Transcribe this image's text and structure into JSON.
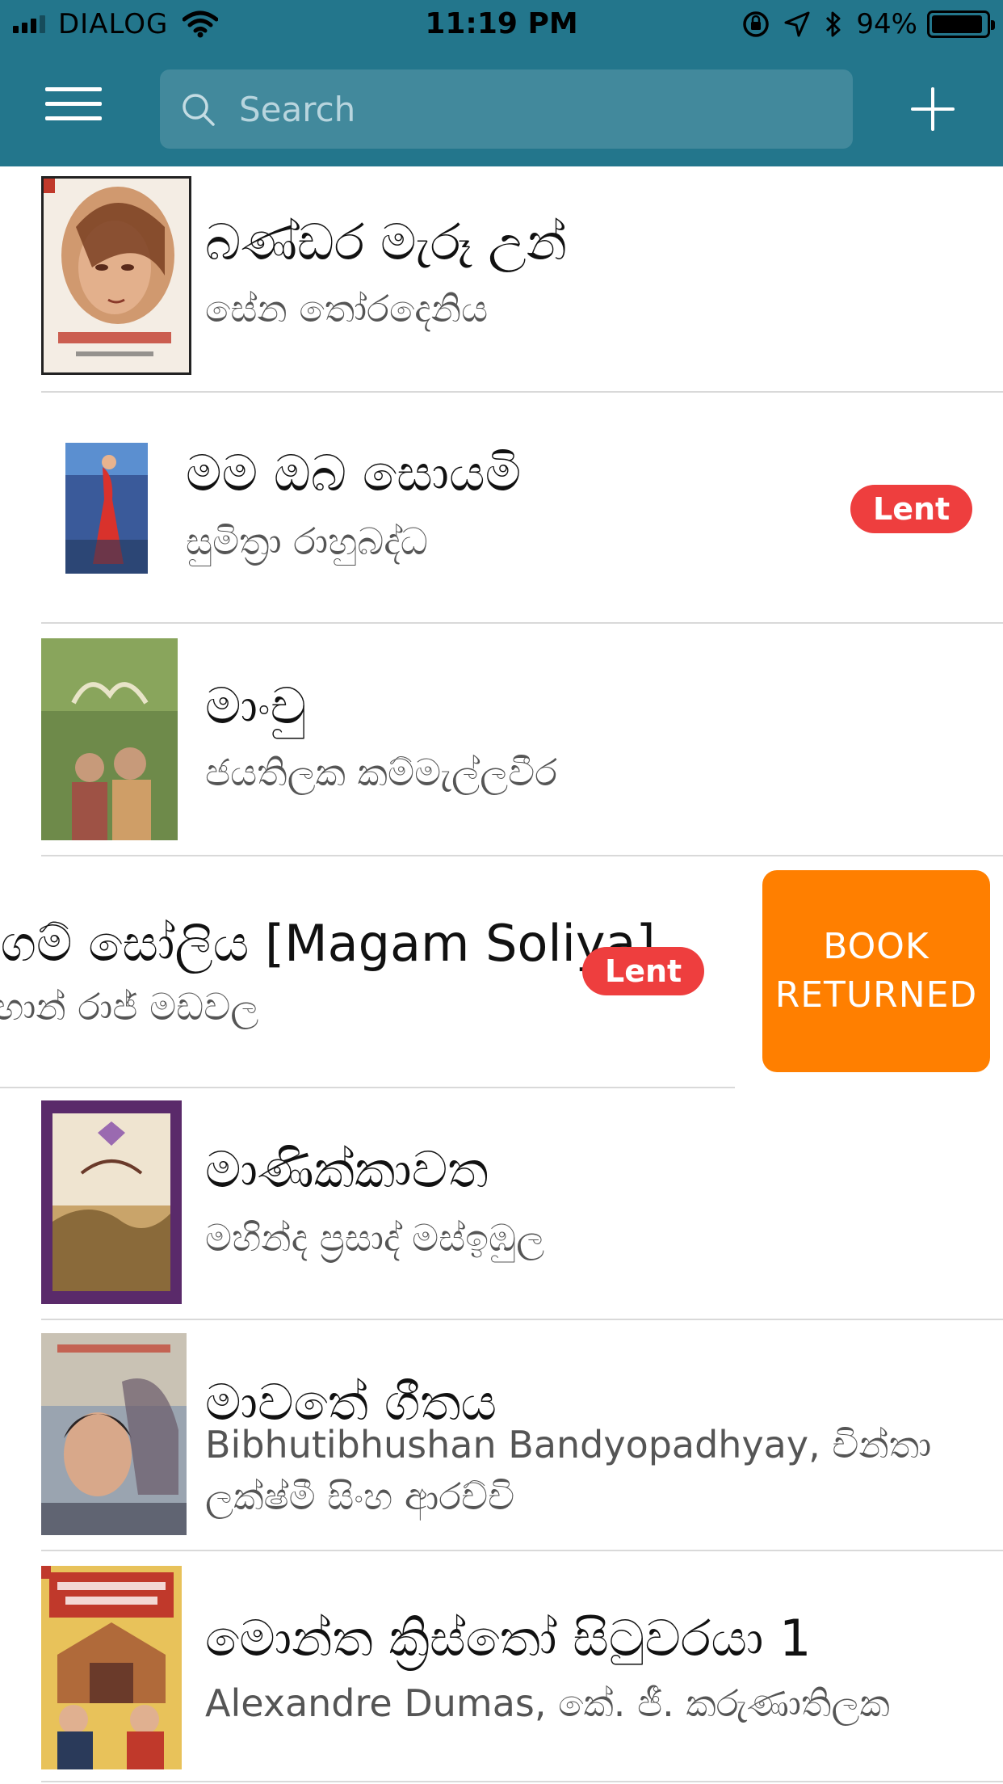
{
  "status_bar": {
    "carrier": "DIALOG",
    "time": "11:19 PM",
    "battery": "94%",
    "battery_level": 0.94
  },
  "header": {
    "search_placeholder": "Search"
  },
  "colors": {
    "header": "#23768c",
    "lent_badge": "#ee3e3e",
    "action_button": "#ff7f00"
  },
  "books": [
    {
      "title": "බණ්ඩර මැරූ උන්",
      "author": "සේන තෝරදෙනිය",
      "lent": false
    },
    {
      "title": "මම ඔබ සොයමි",
      "author": "සුමිත්‍රා රාහුබද්ධ",
      "lent": true,
      "badge": "Lent"
    },
    {
      "title": "මාංචු",
      "author": "ජයතිලක කම්මැල්ලවීර",
      "lent": false
    },
    {
      "title": "මගම් සෝලිය [Magam Soliya]",
      "author": "මහාන් රාජ් මඩවල",
      "lent": true,
      "badge": "Lent",
      "swiped": true
    },
    {
      "title": "මාණික්කාවත",
      "author": "මහින්ද ප්‍රසාද් මස්ඉඹුල",
      "lent": false
    },
    {
      "title": "මාවතේ ගීතය",
      "author_line1": "Bibhutibhushan Bandyopadhyay, චින්තා",
      "author_line2": "ලක්ෂ්මී සිංහ ආරච්චි",
      "lent": false
    },
    {
      "title": "මොන්ත ක්‍රිස්තෝ සිටුවරයා 1",
      "author": "Alexandre Dumas, කේ. ජී. කරුණාතිලක",
      "lent": false
    }
  ],
  "swipe_action": {
    "line1": "BOOK",
    "line2": "RETURNED"
  }
}
